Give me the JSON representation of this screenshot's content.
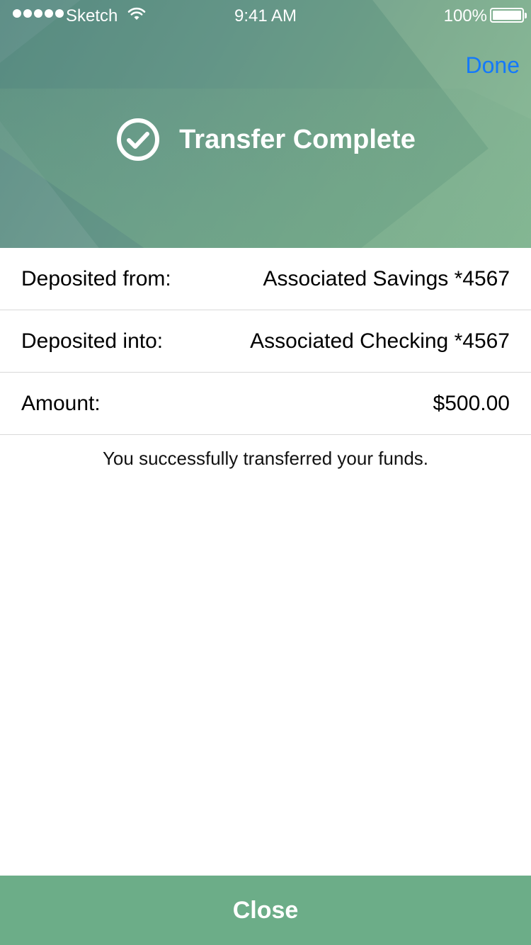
{
  "status_bar": {
    "carrier": "Sketch",
    "time": "9:41 AM",
    "battery": "100%"
  },
  "header": {
    "done_label": "Done",
    "title": "Transfer Complete",
    "icon": "check-circle-icon"
  },
  "details": [
    {
      "label": "Deposited from:",
      "value": "Associated Savings *4567"
    },
    {
      "label": "Deposited into:",
      "value": "Associated Checking *4567"
    },
    {
      "label": "Amount:",
      "value": "$500.00"
    }
  ],
  "message": "You successfully transferred your funds.",
  "footer": {
    "close_label": "Close"
  },
  "colors": {
    "accent": "#1479fb",
    "button": "#6cad88",
    "header_start": "#5f8f88",
    "header_end": "#8cbc98"
  }
}
